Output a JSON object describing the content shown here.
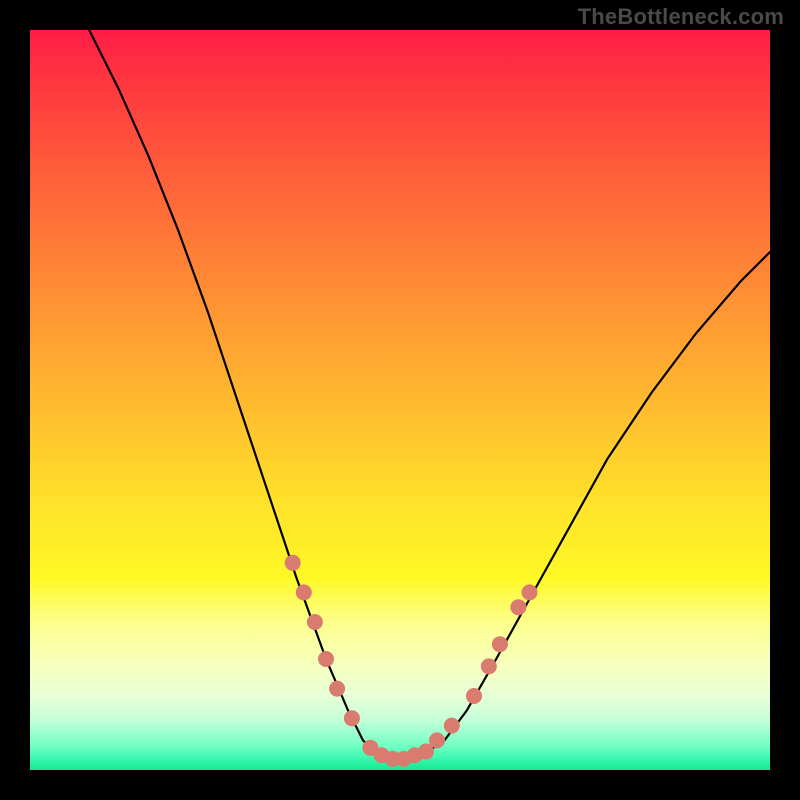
{
  "watermark": "TheBottleneck.com",
  "colors": {
    "background_border": "#000000",
    "curve": "#000000",
    "dot": "#d97b6e",
    "gradient_top": "#ff1c47",
    "gradient_bottom": "#12e98f"
  },
  "chart_data": {
    "type": "line",
    "title": "",
    "xlabel": "",
    "ylabel": "",
    "xlim": [
      0,
      100
    ],
    "ylim": [
      0,
      100
    ],
    "curve_points": [
      {
        "x": 8,
        "y": 100
      },
      {
        "x": 12,
        "y": 92
      },
      {
        "x": 16,
        "y": 83
      },
      {
        "x": 20,
        "y": 73
      },
      {
        "x": 24,
        "y": 62
      },
      {
        "x": 28,
        "y": 50
      },
      {
        "x": 32,
        "y": 38
      },
      {
        "x": 36,
        "y": 26
      },
      {
        "x": 40,
        "y": 15
      },
      {
        "x": 43,
        "y": 8
      },
      {
        "x": 45,
        "y": 4
      },
      {
        "x": 47,
        "y": 2
      },
      {
        "x": 50,
        "y": 1
      },
      {
        "x": 53,
        "y": 2
      },
      {
        "x": 56,
        "y": 4
      },
      {
        "x": 59,
        "y": 8
      },
      {
        "x": 63,
        "y": 15
      },
      {
        "x": 68,
        "y": 24
      },
      {
        "x": 73,
        "y": 33
      },
      {
        "x": 78,
        "y": 42
      },
      {
        "x": 84,
        "y": 51
      },
      {
        "x": 90,
        "y": 59
      },
      {
        "x": 96,
        "y": 66
      },
      {
        "x": 100,
        "y": 70
      }
    ],
    "dots": [
      {
        "x": 35.5,
        "y": 28
      },
      {
        "x": 37.0,
        "y": 24
      },
      {
        "x": 38.5,
        "y": 20
      },
      {
        "x": 40.0,
        "y": 15
      },
      {
        "x": 41.5,
        "y": 11
      },
      {
        "x": 43.5,
        "y": 7
      },
      {
        "x": 46.0,
        "y": 3
      },
      {
        "x": 47.5,
        "y": 2
      },
      {
        "x": 49.0,
        "y": 1.5
      },
      {
        "x": 50.5,
        "y": 1.5
      },
      {
        "x": 52.0,
        "y": 2
      },
      {
        "x": 53.5,
        "y": 2.5
      },
      {
        "x": 55.0,
        "y": 4
      },
      {
        "x": 57.0,
        "y": 6
      },
      {
        "x": 60.0,
        "y": 10
      },
      {
        "x": 62.0,
        "y": 14
      },
      {
        "x": 63.5,
        "y": 17
      },
      {
        "x": 66.0,
        "y": 22
      },
      {
        "x": 67.5,
        "y": 24
      }
    ]
  }
}
